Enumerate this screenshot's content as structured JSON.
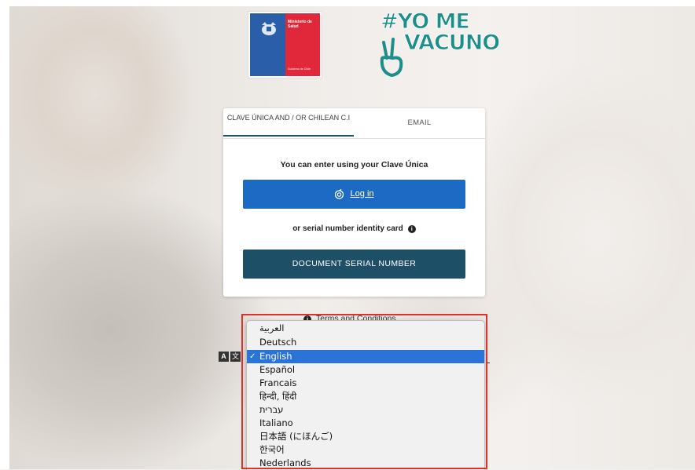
{
  "header": {
    "ministry_logo": {
      "line1": "Ministerio de Salud",
      "line2": "Gobierno de Chile"
    },
    "campaign_logo": {
      "line1": "#YO ME",
      "line2": "VACUNO"
    }
  },
  "login": {
    "tabs": [
      {
        "label": "CLAVE ÚNICA AND / OR CHILEAN C.I",
        "active": true
      },
      {
        "label": "EMAIL",
        "active": false
      }
    ],
    "intro_text": "You can enter using your Clave Única",
    "login_button_label": "Log in",
    "or_text": "or serial number identity card",
    "serial_button_label": "DOCUMENT SERIAL NUMBER"
  },
  "footer": {
    "terms_label": "Terms and Conditions"
  },
  "language_dropdown": {
    "selected": "English",
    "options": [
      "العربية",
      "Deutsch",
      "English",
      "Español",
      "Francais",
      "हिन्दी, हिंदी",
      "עברית",
      "Italiano",
      "日本語 (にほんご)",
      "한국어",
      "Nederlands"
    ],
    "check_mark": "✓"
  },
  "translate_icons": {
    "a": "A",
    "b": "文"
  },
  "colors": {
    "primary_blue": "#1c6ac4",
    "dark_teal": "#1d4f67",
    "selected_option": "#2a73d9",
    "highlight_box": "#e0302a",
    "campaign_teal": "#1d8f8a"
  }
}
